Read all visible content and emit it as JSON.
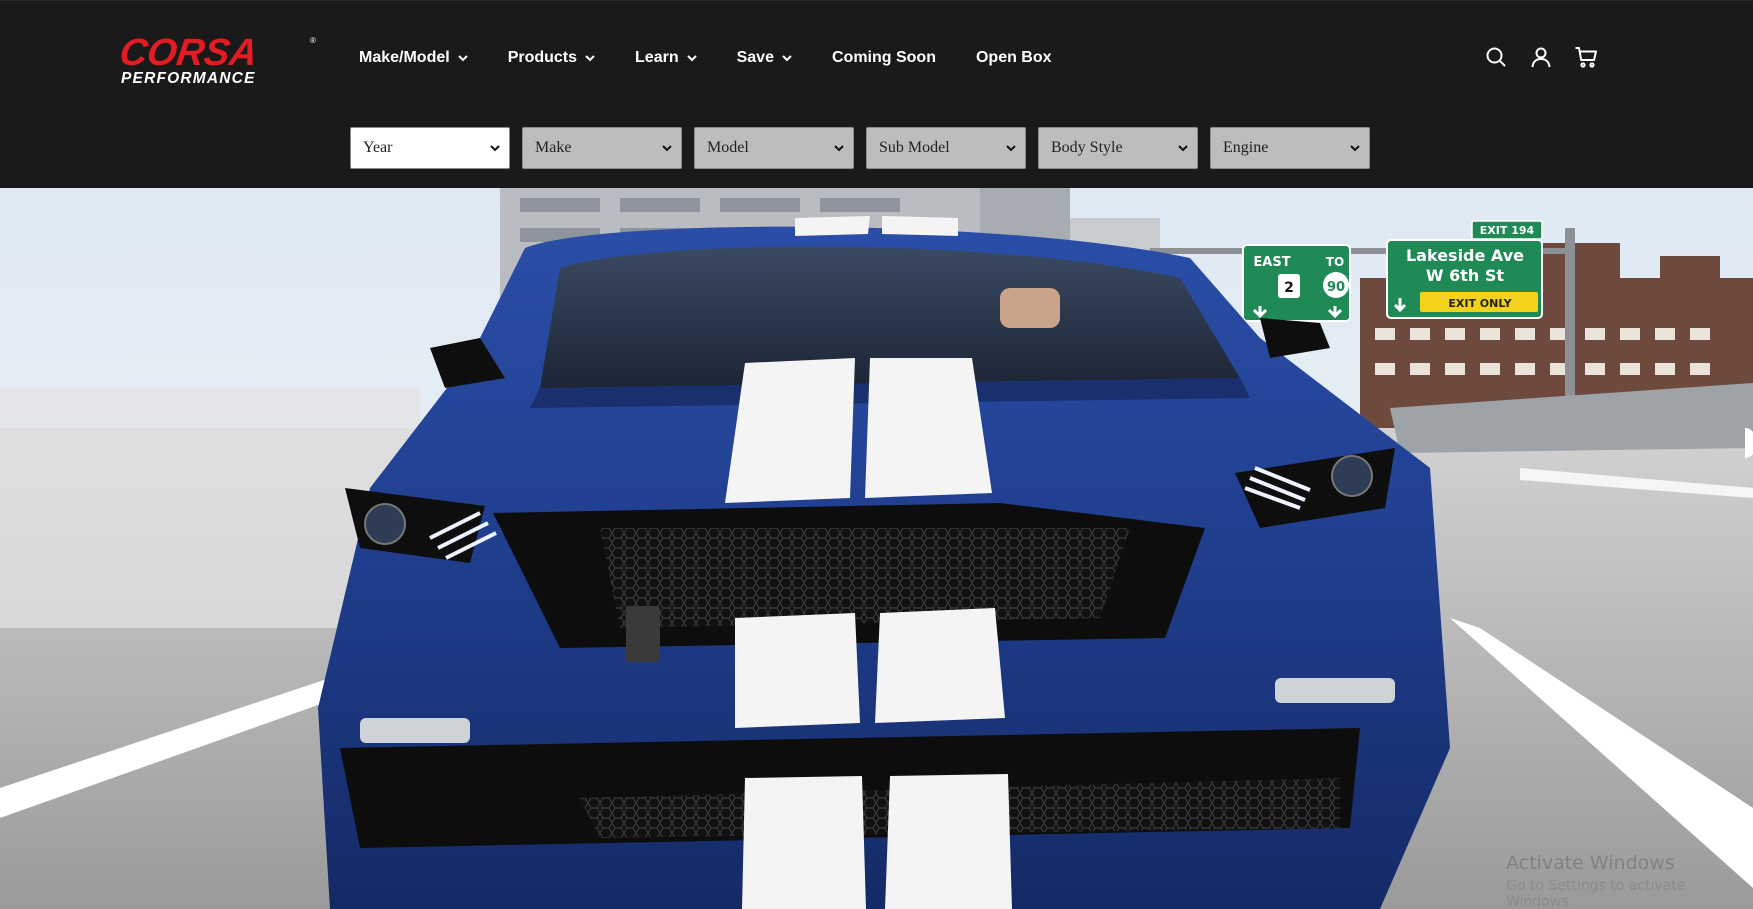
{
  "brand": {
    "name": "CORSA",
    "tagline": "PERFORMANCE",
    "registered_mark": "®",
    "brand_red": "#e31b23"
  },
  "nav": {
    "items": [
      {
        "label": "Make/Model",
        "dropdown": true
      },
      {
        "label": "Products",
        "dropdown": true
      },
      {
        "label": "Learn",
        "dropdown": true
      },
      {
        "label": "Save",
        "dropdown": true
      },
      {
        "label": "Coming Soon",
        "dropdown": false
      },
      {
        "label": "Open Box",
        "dropdown": false
      }
    ]
  },
  "header_icons": [
    "search-icon",
    "account-icon",
    "cart-icon"
  ],
  "vehicle_filters": [
    {
      "label": "Year",
      "enabled": true
    },
    {
      "label": "Make",
      "enabled": false
    },
    {
      "label": "Model",
      "enabled": false
    },
    {
      "label": "Sub Model",
      "enabled": false
    },
    {
      "label": "Body Style",
      "enabled": false
    },
    {
      "label": "Engine",
      "enabled": false
    }
  ],
  "hero": {
    "signs": {
      "green_sign": {
        "east": "EAST",
        "to": "TO",
        "route1": "2",
        "route2": "90"
      },
      "exit_tab": "EXIT 194",
      "lakeside_line1": "Lakeside Ave",
      "lakeside_line2": "W 6th St",
      "exit_only": "EXIT ONLY"
    }
  },
  "os_watermark": {
    "line1": "Activate Windows",
    "line2": "Go to Settings to activate Windows."
  },
  "colors": {
    "header_bg": "#1a1a1a",
    "car_blue": "#1f3d8c",
    "sign_green": "#1f8a55"
  }
}
